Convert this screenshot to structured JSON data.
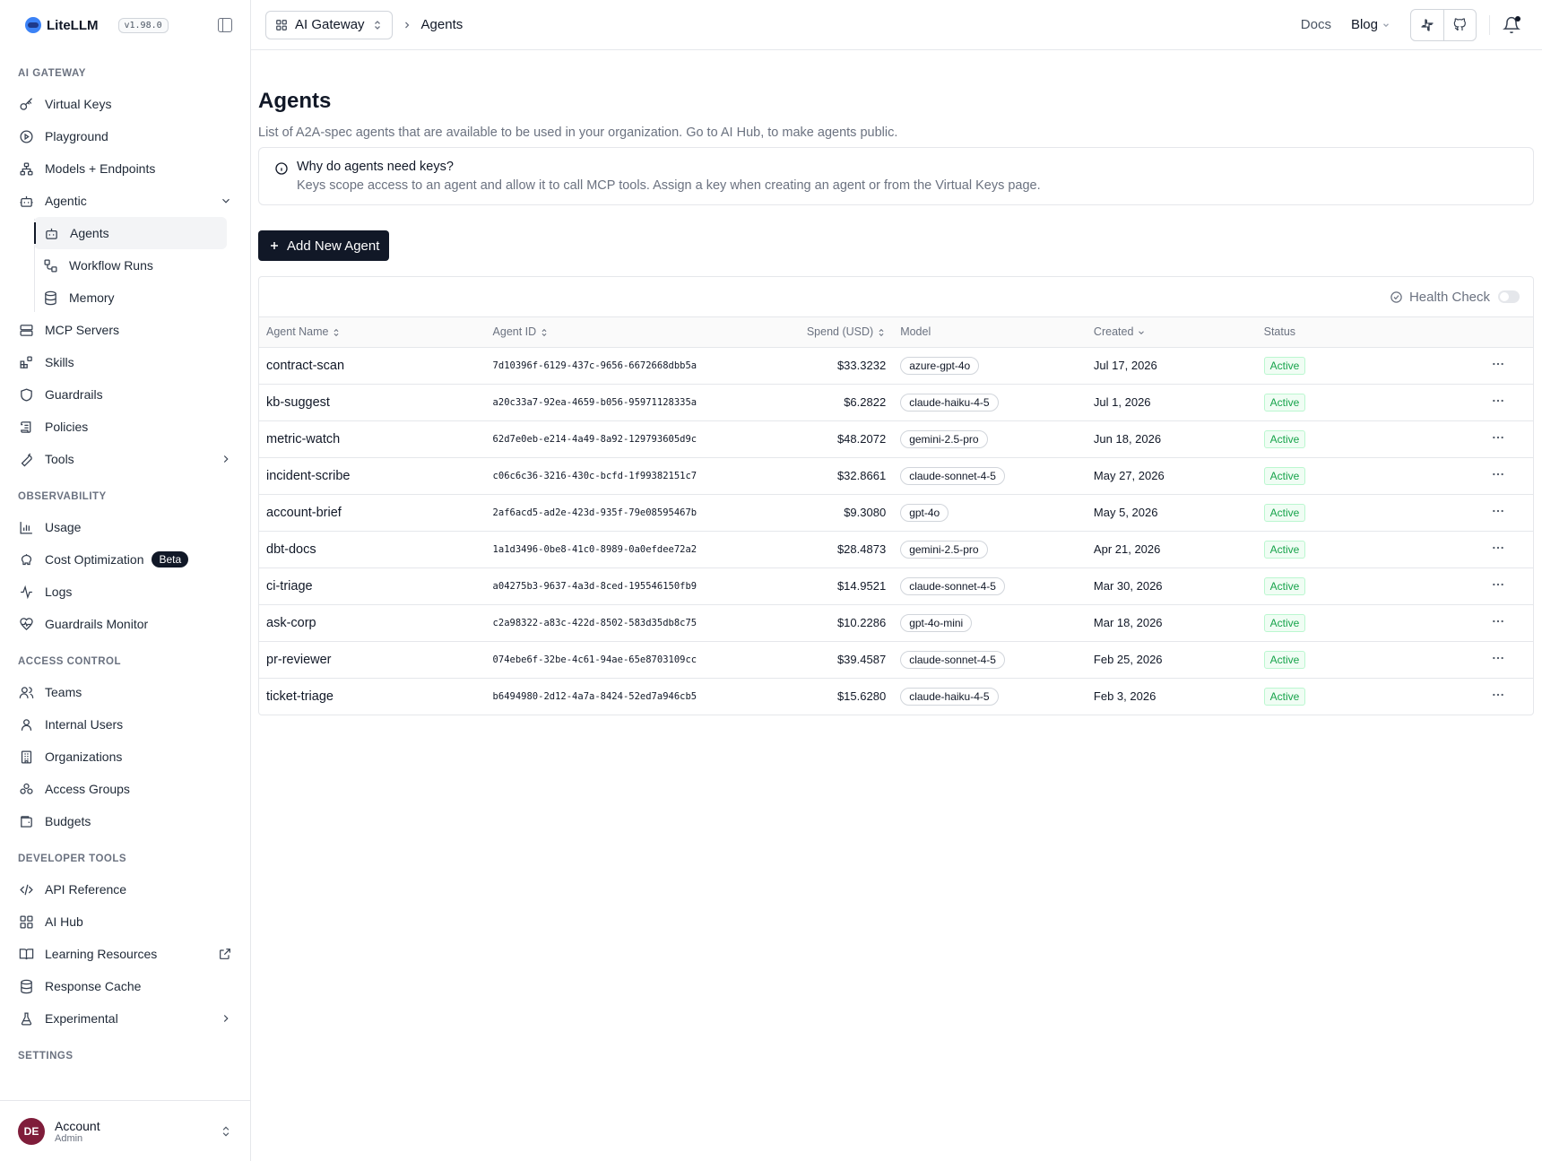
{
  "brand": {
    "name": "LiteLLM",
    "version": "v1.98.0"
  },
  "sidebar": {
    "sections": {
      "ai_gateway": "AI GATEWAY",
      "observability": "OBSERVABILITY",
      "access_control": "ACCESS CONTROL",
      "developer_tools": "DEVELOPER TOOLS",
      "settings": "SETTINGS"
    },
    "items": {
      "virtual_keys": "Virtual Keys",
      "playground": "Playground",
      "models_endpoints": "Models + Endpoints",
      "agentic": "Agentic",
      "agents": "Agents",
      "workflow_runs": "Workflow Runs",
      "memory": "Memory",
      "mcp_servers": "MCP Servers",
      "skills": "Skills",
      "guardrails": "Guardrails",
      "policies": "Policies",
      "tools": "Tools",
      "usage": "Usage",
      "cost_optimization": "Cost Optimization",
      "beta_badge": "Beta",
      "logs": "Logs",
      "guardrails_monitor": "Guardrails Monitor",
      "teams": "Teams",
      "internal_users": "Internal Users",
      "organizations": "Organizations",
      "access_groups": "Access Groups",
      "budgets": "Budgets",
      "api_reference": "API Reference",
      "ai_hub": "AI Hub",
      "learning_resources": "Learning Resources",
      "response_cache": "Response Cache",
      "experimental": "Experimental"
    },
    "account": {
      "initials": "DE",
      "name": "Account",
      "role": "Admin"
    }
  },
  "topbar": {
    "gateway_select": "AI Gateway",
    "breadcrumb": "Agents",
    "docs": "Docs",
    "blog": "Blog"
  },
  "page": {
    "title": "Agents",
    "description": "List of A2A-spec agents that are available to be used in your organization. Go to AI Hub, to make agents public.",
    "callout_title": "Why do agents need keys?",
    "callout_body": "Keys scope access to an agent and allow it to call MCP tools. Assign a key when creating an agent or from the Virtual Keys page.",
    "add_button": "Add New Agent",
    "health_check": "Health Check"
  },
  "table": {
    "columns": {
      "name": "Agent Name",
      "id": "Agent ID",
      "spend": "Spend (USD)",
      "model": "Model",
      "created": "Created",
      "status": "Status"
    },
    "rows": [
      {
        "name": "contract-scan",
        "id": "7d10396f-6129-437c-9656-6672668dbb5a",
        "spend": "$33.3232",
        "model": "azure-gpt-4o",
        "created": "Jul 17, 2026",
        "status": "Active"
      },
      {
        "name": "kb-suggest",
        "id": "a20c33a7-92ea-4659-b056-95971128335a",
        "spend": "$6.2822",
        "model": "claude-haiku-4-5",
        "created": "Jul 1, 2026",
        "status": "Active"
      },
      {
        "name": "metric-watch",
        "id": "62d7e0eb-e214-4a49-8a92-129793605d9c",
        "spend": "$48.2072",
        "model": "gemini-2.5-pro",
        "created": "Jun 18, 2026",
        "status": "Active"
      },
      {
        "name": "incident-scribe",
        "id": "c06c6c36-3216-430c-bcfd-1f99382151c7",
        "spend": "$32.8661",
        "model": "claude-sonnet-4-5",
        "created": "May 27, 2026",
        "status": "Active"
      },
      {
        "name": "account-brief",
        "id": "2af6acd5-ad2e-423d-935f-79e08595467b",
        "spend": "$9.3080",
        "model": "gpt-4o",
        "created": "May 5, 2026",
        "status": "Active"
      },
      {
        "name": "dbt-docs",
        "id": "1a1d3496-0be8-41c0-8989-0a0efdee72a2",
        "spend": "$28.4873",
        "model": "gemini-2.5-pro",
        "created": "Apr 21, 2026",
        "status": "Active"
      },
      {
        "name": "ci-triage",
        "id": "a04275b3-9637-4a3d-8ced-195546150fb9",
        "spend": "$14.9521",
        "model": "claude-sonnet-4-5",
        "created": "Mar 30, 2026",
        "status": "Active"
      },
      {
        "name": "ask-corp",
        "id": "c2a98322-a83c-422d-8502-583d35db8c75",
        "spend": "$10.2286",
        "model": "gpt-4o-mini",
        "created": "Mar 18, 2026",
        "status": "Active"
      },
      {
        "name": "pr-reviewer",
        "id": "074ebe6f-32be-4c61-94ae-65e8703109cc",
        "spend": "$39.4587",
        "model": "claude-sonnet-4-5",
        "created": "Feb 25, 2026",
        "status": "Active"
      },
      {
        "name": "ticket-triage",
        "id": "b6494980-2d12-4a7a-8424-52ed7a946cb5",
        "spend": "$15.6280",
        "model": "claude-haiku-4-5",
        "created": "Feb 3, 2026",
        "status": "Active"
      }
    ]
  },
  "colors": {
    "primary": "#111827",
    "active_status": "#16a34a",
    "muted_text": "#6b7280",
    "border": "#e5e7eb"
  }
}
